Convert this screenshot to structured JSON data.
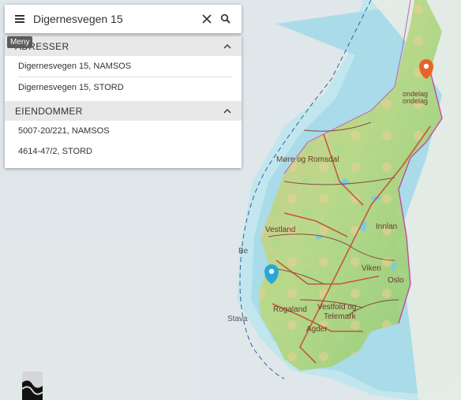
{
  "search": {
    "value": "Digernesvegen 15"
  },
  "tooltip": "Meny",
  "sections": [
    {
      "title": "ADRESSER",
      "items": [
        "Digernesvegen 15, NAMSOS",
        "Digernesvegen 15, STORD"
      ]
    },
    {
      "title": "EIENDOMMER",
      "items": [
        "5007-20/221, NAMSOS",
        "4614-47/2, STORD"
      ]
    }
  ],
  "map_labels": {
    "more": "Møre og Romsdal",
    "trondelag1": "ondelag",
    "trondelag2": "ondelag",
    "vestland": "Vestland",
    "innlandet": "Innlan",
    "viken": "Viken",
    "oslo": "Oslo",
    "rogaland": "Rogaland",
    "vestfold1": "Vestfold og",
    "vestfold2": "Telemark",
    "agder": "Agder",
    "bergen": "Be",
    "stavanger": "Stava"
  },
  "markers": [
    {
      "name": "namsos-marker",
      "color": "#e8632a"
    },
    {
      "name": "stord-marker",
      "color": "#2aa7d8"
    }
  ]
}
